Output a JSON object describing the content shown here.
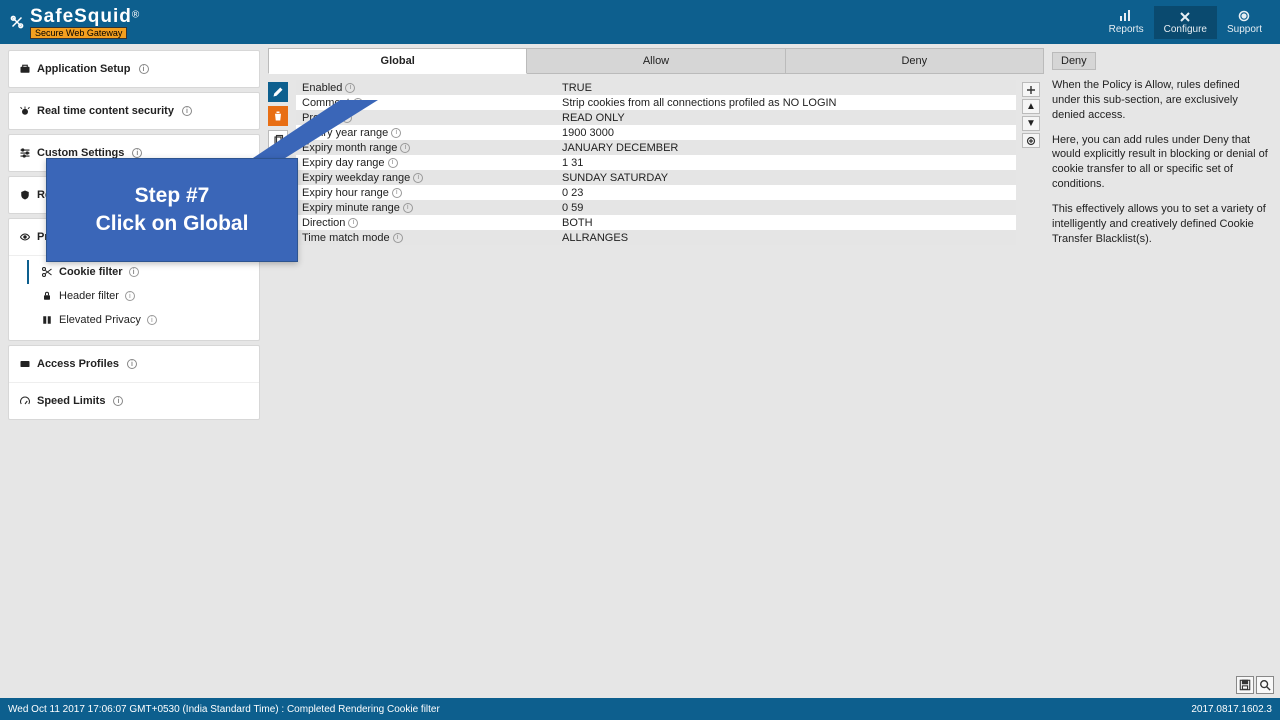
{
  "brand": {
    "name": "SafeSquid",
    "tag": "Secure Web Gateway",
    "reg": "®"
  },
  "topnav": [
    {
      "label": "Reports",
      "active": false
    },
    {
      "label": "Configure",
      "active": true
    },
    {
      "label": "Support",
      "active": false
    }
  ],
  "sidebar": {
    "items": [
      {
        "label": "Application Setup"
      },
      {
        "label": "Real time content security"
      },
      {
        "label": "Custom Settings"
      },
      {
        "label": "Restriction Policies"
      },
      {
        "label": "Privacy Control",
        "children": [
          {
            "label": "Cookie filter",
            "active": true
          },
          {
            "label": "Header filter"
          },
          {
            "label": "Elevated Privacy"
          }
        ]
      },
      {
        "label": "Access Profiles"
      },
      {
        "label": "Speed Limits"
      }
    ]
  },
  "tabs": [
    {
      "label": "Global",
      "active": true
    },
    {
      "label": "Allow",
      "active": false
    },
    {
      "label": "Deny",
      "active": false
    }
  ],
  "grid_left_icons": [
    "edit",
    "delete",
    "copy"
  ],
  "grid_ctrls": [
    "add",
    "up",
    "down",
    "more"
  ],
  "rows": [
    {
      "label": "Enabled",
      "value": "TRUE"
    },
    {
      "label": "Comment",
      "value": "Strip cookies from all connections profiled as NO LOGIN"
    },
    {
      "label": "Profiles",
      "value": "READ ONLY"
    },
    {
      "label": "Expiry year range",
      "value": "1900  3000"
    },
    {
      "label": "Expiry month range",
      "value": "JANUARY  DECEMBER"
    },
    {
      "label": "Expiry day range",
      "value": "1  31"
    },
    {
      "label": "Expiry weekday range",
      "value": "SUNDAY  SATURDAY"
    },
    {
      "label": "Expiry hour range",
      "value": "0  23"
    },
    {
      "label": "Expiry minute range",
      "value": "0  59"
    },
    {
      "label": "Direction",
      "value": "BOTH"
    },
    {
      "label": "Time match mode",
      "value": "ALLRANGES"
    }
  ],
  "info": {
    "title": "Deny",
    "p1": "When the Policy is Allow, rules defined under this sub-section, are exclusively denied access.",
    "p2": "Here, you can add rules under Deny that would explicitly result in blocking or denial of cookie transfer to all or specific set of conditions.",
    "p3": "This effectively allows you to set a variety of intelligently and creatively defined Cookie Transfer Blacklist(s)."
  },
  "callout": {
    "line1": "Step #7",
    "line2": "Click on Global"
  },
  "footer": {
    "status": "Wed Oct 11 2017 17:06:07 GMT+0530 (India Standard Time) : Completed Rendering Cookie filter",
    "version": "2017.0817.1602.3"
  },
  "colors": {
    "brand": "#0d5f8e",
    "callout": "#3a66b8",
    "tag": "#f39f1f"
  }
}
